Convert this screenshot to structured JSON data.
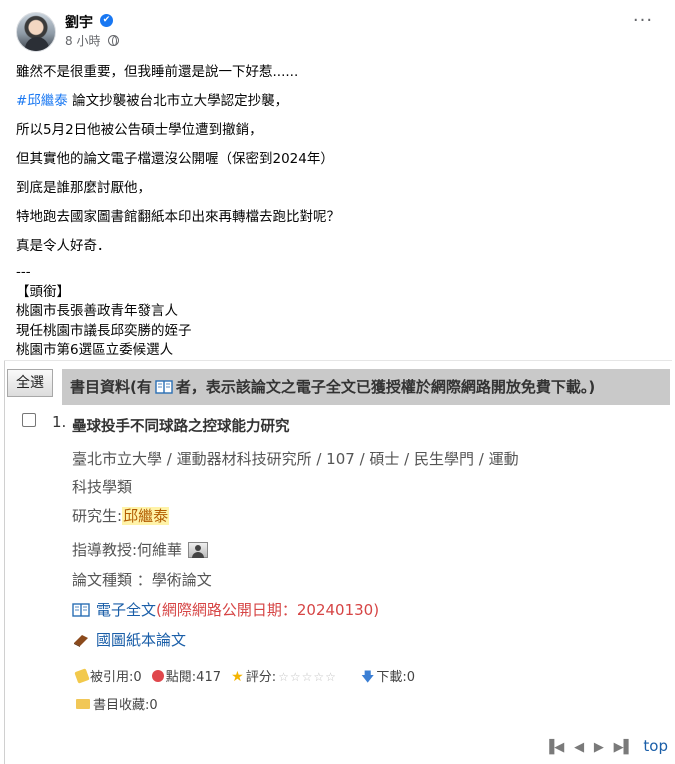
{
  "post": {
    "author": "劉宇",
    "verified_mark": "✔",
    "time": "8 小時",
    "more": "···",
    "lines": [
      "雖然不是很重要，但我睡前還是說一下好惹......",
      "論文抄襲被台北市立大學認定抄襲，",
      "所以5月2日他被公告碩士學位遭到撤銷，",
      "但其實他的論文電子檔還沒公開喔（保密到2024年）",
      "到底是誰那麼討厭他，",
      "特地跑去國家圖書館翻紙本印出來再轉檔去跑比對呢？",
      "真是令人好奇．"
    ],
    "hashtag": "#邱繼泰",
    "separator": "---",
    "title_tag": "【頭銜】",
    "titles": [
      "桃園市長張善政青年發言人",
      "現任桃園市議長邱奕勝的姪子",
      "桃園市第6選區立委候選人"
    ]
  },
  "embed": {
    "select_all": "全選",
    "header_prefix": "書目資料(有",
    "header_suffix": "者，表示該論文之電子全文已獲授權於網際網路開放免費下載。)",
    "item": {
      "number": "1.",
      "title": "壘球投手不同球路之控球能力研究",
      "dept": "臺北市立大學 / 運動器材科技研究所 / 107 / 碩士 / 民生學門 / 運動科技學類",
      "student_label": "研究生:",
      "student_name": "邱繼泰",
      "advisor": "指導教授:何維華",
      "type": "論文種類 ：學術論文",
      "ebook_label": "電子全文",
      "ebook_date": "(網際網路公開日期：20240130)",
      "paper_label": "國圖紙本論文"
    },
    "stats": {
      "cited": "被引用:0",
      "views": "點閱:417",
      "rating_label": "評分:",
      "rating_stars": "☆☆☆☆☆",
      "downloads": "下載:0",
      "bookmarks": "書目收藏:0"
    },
    "pager": {
      "first": "▐◀",
      "prev": "◀",
      "next": "▶",
      "last": "▶▌",
      "top": "top"
    }
  }
}
